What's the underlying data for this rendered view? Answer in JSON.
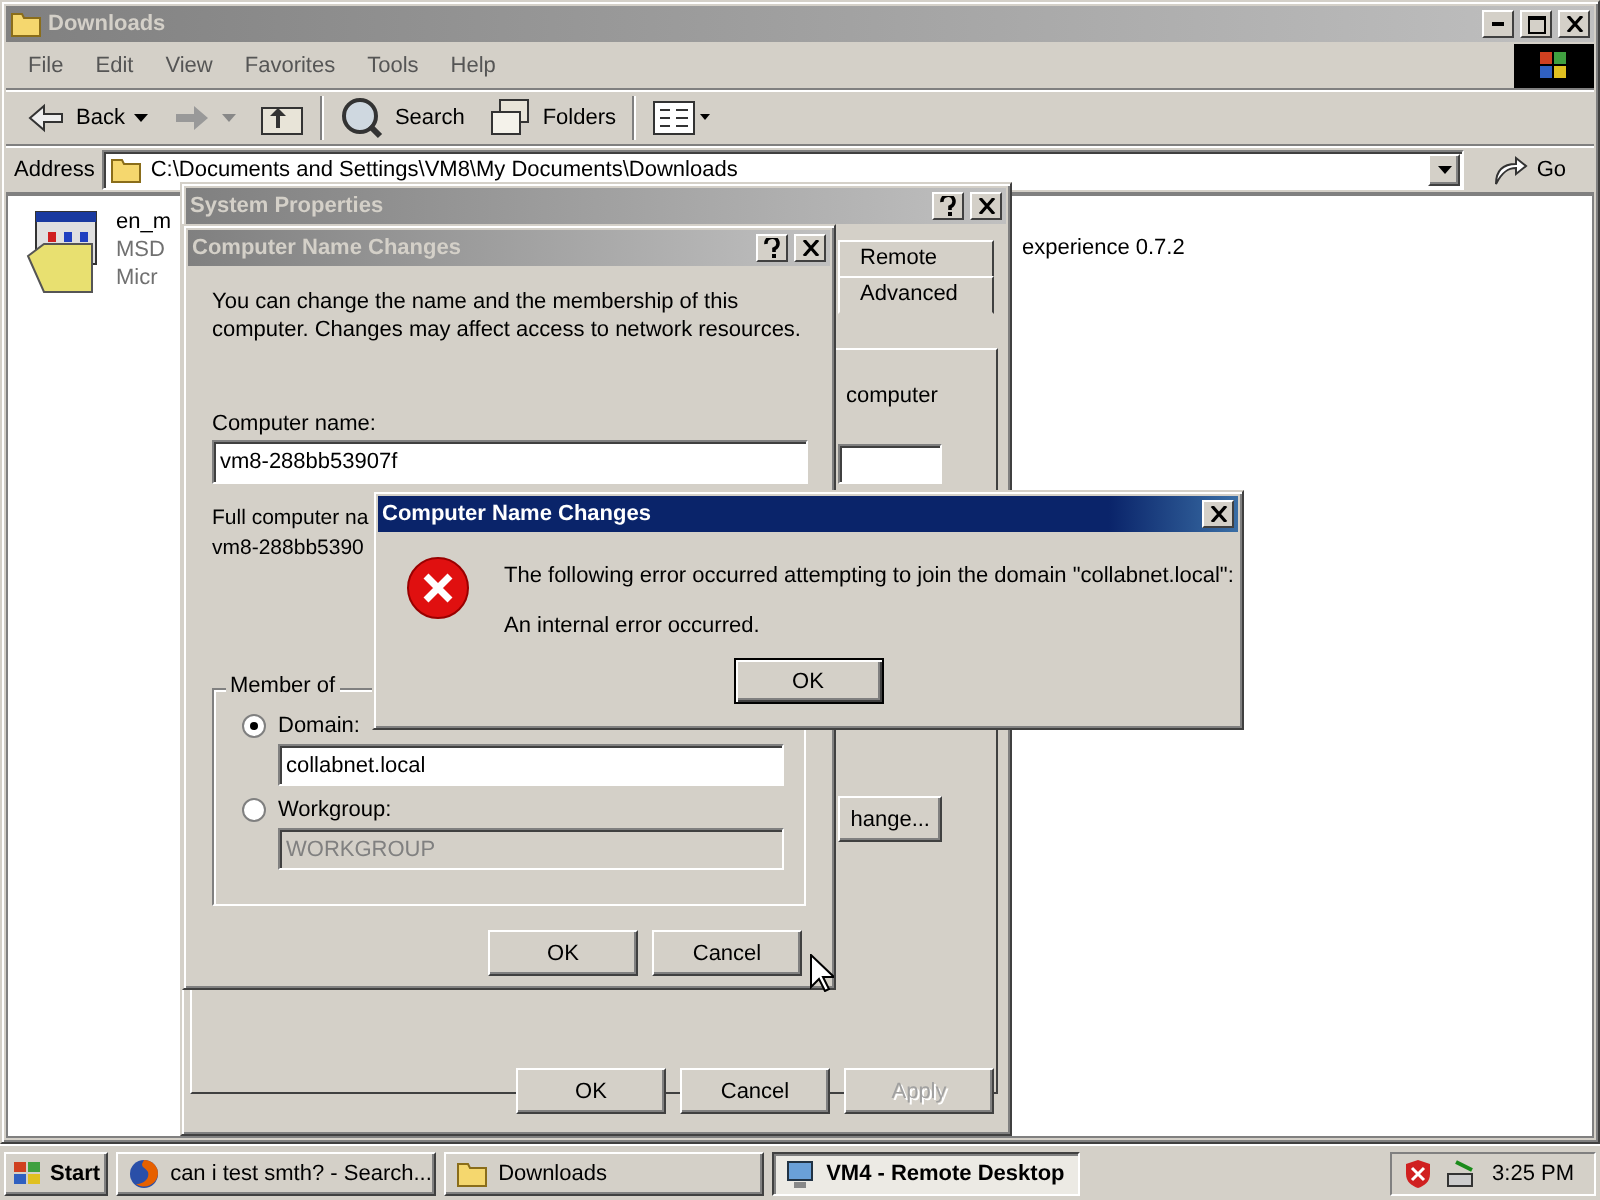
{
  "explorer": {
    "title": "Downloads",
    "active": false,
    "menu": [
      "File",
      "Edit",
      "View",
      "Favorites",
      "Tools",
      "Help"
    ],
    "toolbar": [
      {
        "kind": "back",
        "label": "Back"
      },
      {
        "kind": "forward"
      },
      {
        "kind": "up"
      },
      {
        "kind": "search",
        "label": "Search"
      },
      {
        "kind": "folders",
        "label": "Folders"
      },
      {
        "kind": "views"
      }
    ],
    "address": {
      "label": "Address",
      "value": "C:\\Documents and Settings\\VM8\\My Documents\\Downloads",
      "go": "Go"
    },
    "file": {
      "name": "en_m",
      "lines": [
        "MSD",
        "Micr"
      ],
      "name_tail": "experience 0.7.2"
    }
  },
  "system_properties": {
    "title": "System Properties",
    "active": false,
    "tabs": [
      {
        "label": "Remote",
        "selected": false
      },
      {
        "label": "Advanced",
        "selected": false
      }
    ],
    "panel_text": "computer",
    "change_button": "hange...",
    "buttons": [
      {
        "label": "OK",
        "disabled": false
      },
      {
        "label": "Cancel",
        "disabled": false
      },
      {
        "label": "Apply",
        "disabled": true
      }
    ]
  },
  "name_changes": {
    "title": "Computer Name Changes",
    "active": false,
    "description": "You can change the name and the membership of this computer. Changes may affect access to network resources.",
    "computer_name_label": "Computer name:",
    "computer_name": "vm8-288bb53907f",
    "full_name_label": "Full computer na",
    "full_name": "vm8-288bb5390",
    "member_of": "Member of",
    "options": [
      {
        "label": "Domain:",
        "selected": true,
        "value": "collabnet.local",
        "disabled": false
      },
      {
        "label": "Workgroup:",
        "selected": false,
        "value": "WORKGROUP",
        "disabled": true
      }
    ],
    "buttons": [
      "OK",
      "Cancel"
    ]
  },
  "error_dialog": {
    "title": "Computer Name Changes",
    "active": true,
    "message": "The following error occurred attempting to join the domain \"collabnet.local\":",
    "detail": "An internal error occurred.",
    "button": "OK"
  },
  "taskbar": {
    "start": "Start",
    "tasks": [
      {
        "kind": "browser",
        "label": "can i test smth? - Search...",
        "selected": false
      },
      {
        "kind": "folder",
        "label": "Downloads",
        "selected": false
      },
      {
        "kind": "remote",
        "label": "VM4 - Remote Desktop",
        "selected": true
      }
    ],
    "clock": "3:25 PM"
  }
}
